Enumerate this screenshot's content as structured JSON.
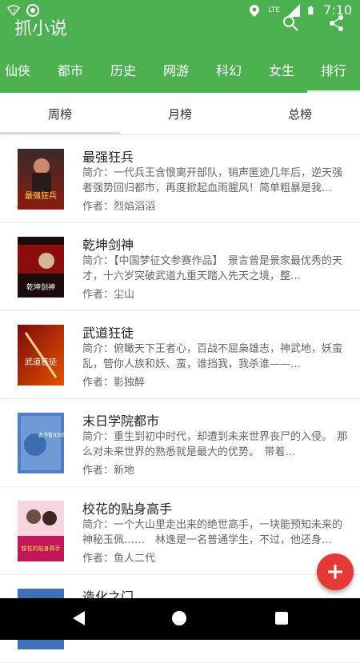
{
  "status_bar": {
    "time": "7:10",
    "network": "LTE"
  },
  "app_bar": {
    "title": "抓小说"
  },
  "categories": [
    {
      "label": "仙侠"
    },
    {
      "label": "都市"
    },
    {
      "label": "历史"
    },
    {
      "label": "网游"
    },
    {
      "label": "科幻"
    },
    {
      "label": "女生"
    },
    {
      "label": "排行"
    }
  ],
  "subtabs": [
    {
      "label": "周榜"
    },
    {
      "label": "月榜"
    },
    {
      "label": "总榜"
    }
  ],
  "books": [
    {
      "title": "最强狂兵",
      "desc": "简介：一代兵王含恨离开部队，销声匿迹几年后，逆天强者强势回归都市，再度掀起血雨腥风！简单粗暴是我…",
      "author": "作者：烈焰滔滔",
      "cover_text": "最强狂兵"
    },
    {
      "title": "乾坤剑神",
      "desc": "简介：【中国梦征文参赛作品】　景言曾是景家最优秀的天才，十六岁突破武道九重天踏入先天之境，整…",
      "author": "作者：尘山",
      "cover_text": "乾坤剑神"
    },
    {
      "title": "武道狂徒",
      "desc": "简介：俯瞰天下王者心，百战不屈枭雄志，神武地，妖蛮乱，管你人族和妖、蛮，谁挡我，我杀谁——…",
      "author": "作者：影独醉",
      "cover_text": "武道狂徒"
    },
    {
      "title": "末日学院都市",
      "desc": "简介：重生到初中时代，却遭到未来世界丧尸的入侵。　那么对未来世界的熟悉就是最大的优势。　带着…",
      "author": "作者：新地",
      "cover_text": "此书暂无封面"
    },
    {
      "title": "校花的贴身高手",
      "desc": "简介：一个大山里走出来的绝世高手，一块能预知未来的神秘玉佩……　林逸是一名普通学生，不过，他还身…",
      "author": "作者：鱼人二代",
      "cover_text": "校花的贴身高手"
    },
    {
      "title": "造化之门",
      "desc": "",
      "author": "",
      "cover_text": ""
    }
  ],
  "colors": {
    "primary": "#4caf50",
    "fab": "#e53935"
  },
  "icons": [
    "search-icon",
    "share-icon",
    "add-icon",
    "back-icon",
    "home-icon",
    "recents-icon"
  ]
}
